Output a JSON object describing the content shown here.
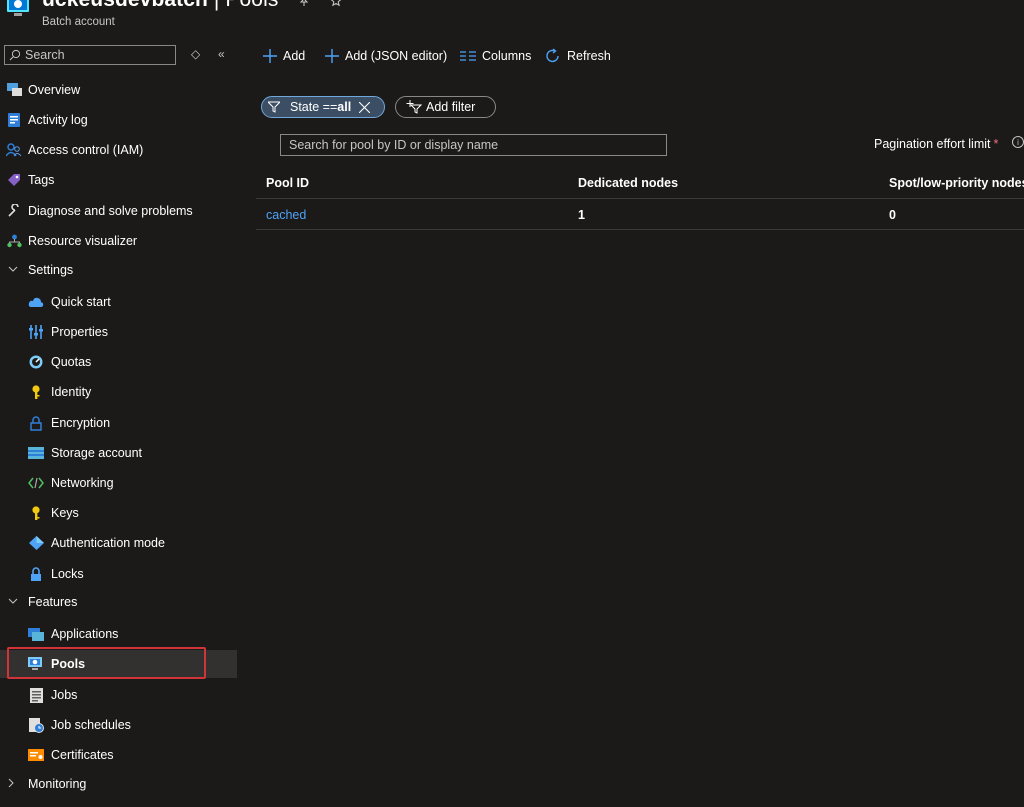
{
  "header": {
    "title": "uckeusdevbatch",
    "title_sep": " | ",
    "page": "Pools",
    "subtitle": "Batch account",
    "more": "···"
  },
  "sidebar": {
    "search_placeholder": "Search",
    "expand_glyph": "◇",
    "collapse_glyph": "«",
    "items": [
      {
        "label": "Overview",
        "icon": "overview-icon"
      },
      {
        "label": "Activity log",
        "icon": "activity-log-icon"
      },
      {
        "label": "Access control (IAM)",
        "icon": "people-icon"
      },
      {
        "label": "Tags",
        "icon": "tag-icon"
      },
      {
        "label": "Diagnose and solve problems",
        "icon": "wrench-icon"
      },
      {
        "label": "Resource visualizer",
        "icon": "hierarchy-icon"
      }
    ],
    "settings": {
      "label": "Settings",
      "items": [
        {
          "label": "Quick start",
          "icon": "cloud-icon"
        },
        {
          "label": "Properties",
          "icon": "sliders-icon"
        },
        {
          "label": "Quotas",
          "icon": "gauge-icon"
        },
        {
          "label": "Identity",
          "icon": "key-person-icon"
        },
        {
          "label": "Encryption",
          "icon": "lock-outline-icon"
        },
        {
          "label": "Storage account",
          "icon": "storage-icon"
        },
        {
          "label": "Networking",
          "icon": "network-icon"
        },
        {
          "label": "Keys",
          "icon": "key-icon"
        },
        {
          "label": "Authentication mode",
          "icon": "diamond-icon"
        },
        {
          "label": "Locks",
          "icon": "lock-icon"
        }
      ]
    },
    "features": {
      "label": "Features",
      "items": [
        {
          "label": "Applications",
          "icon": "applications-icon"
        },
        {
          "label": "Pools",
          "icon": "pool-icon",
          "selected": true
        },
        {
          "label": "Jobs",
          "icon": "jobs-icon"
        },
        {
          "label": "Job schedules",
          "icon": "job-schedule-icon"
        },
        {
          "label": "Certificates",
          "icon": "certificate-icon"
        }
      ]
    },
    "monitoring": {
      "label": "Monitoring"
    }
  },
  "toolbar": {
    "add": "Add",
    "add_json": "Add (JSON editor)",
    "columns": "Columns",
    "refresh": "Refresh"
  },
  "filters": {
    "state_key": "State == ",
    "state_value": "all",
    "add_filter": "Add filter"
  },
  "pool_search": {
    "placeholder": "Search for pool by ID or display name"
  },
  "pagination": {
    "label": "Pagination effort limit",
    "required": "*",
    "info": "i"
  },
  "table": {
    "columns": [
      "Pool ID",
      "Dedicated nodes",
      "Spot/low-priority nodes"
    ],
    "rows": [
      {
        "pool_id": "cached",
        "dedicated": "1",
        "spot": "0"
      }
    ]
  },
  "colors": {
    "background": "#1b1a19",
    "accent": "#4fa3f7",
    "selection_outline": "#d13438"
  }
}
